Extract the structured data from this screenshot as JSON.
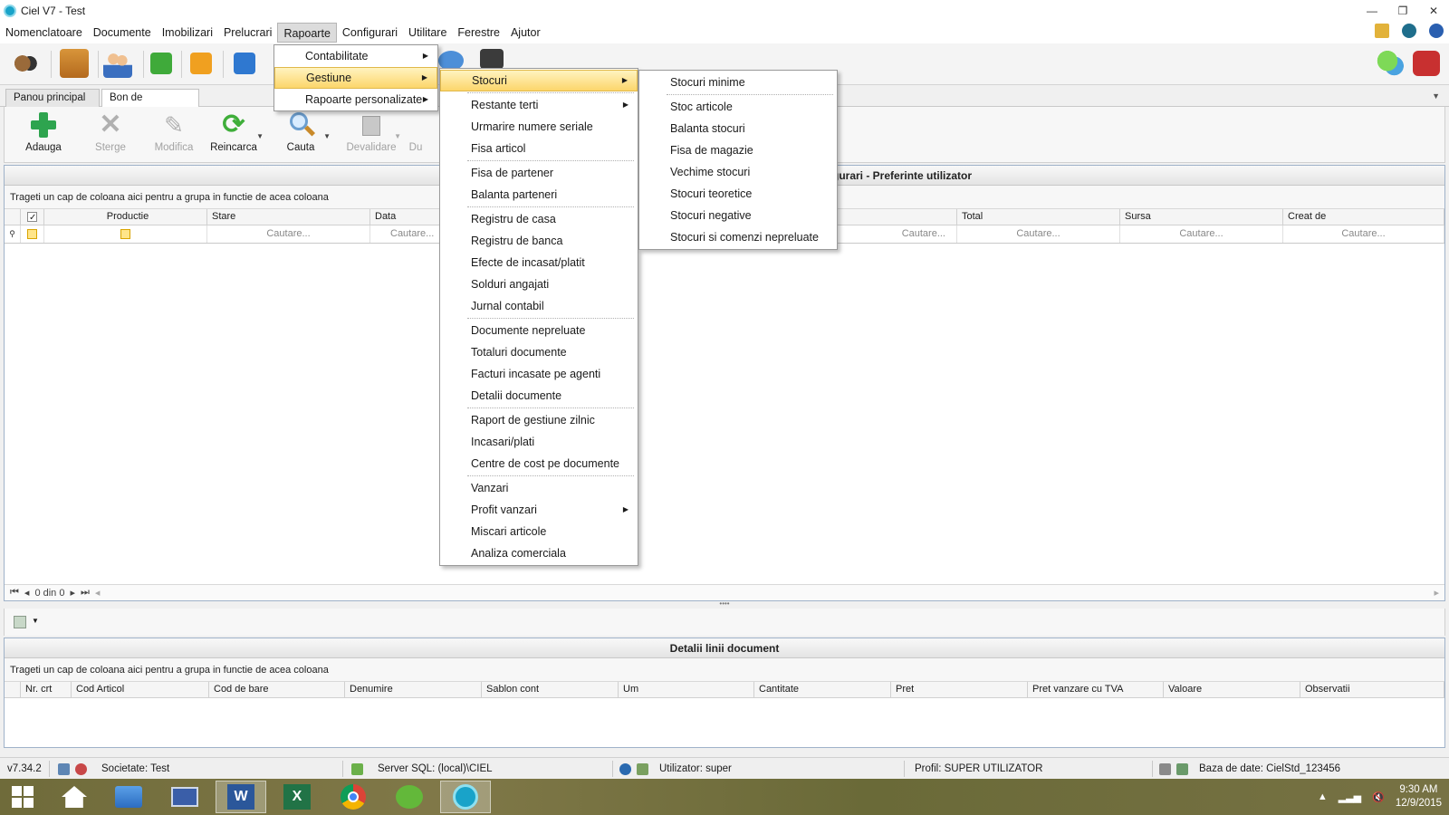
{
  "window": {
    "title": "Ciel V7 - Test",
    "controls": [
      "—",
      "❐",
      "✕"
    ]
  },
  "menubar": {
    "items": [
      "Nomenclatoare",
      "Documente",
      "Imobilizari",
      "Prelucrari",
      "Rapoarte",
      "Configurari",
      "Utilitare",
      "Ferestre",
      "Ajutor"
    ],
    "active": "Rapoarte"
  },
  "tabs": {
    "home": "Panou principal",
    "current": "Bon de consum",
    "close": "✕"
  },
  "ribbon": {
    "add": "Adauga",
    "delete": "Sterge",
    "edit": "Modifica",
    "reload": "Reincarca",
    "search": "Cauta",
    "invalidate": "Devalidare",
    "duplicate": "Du"
  },
  "main_grid": {
    "title_partial": "gurari - Preferinte utilizator",
    "group_hint": "Trageti un cap de coloana aici pentru a grupa in functie de acea coloana",
    "columns_left": [
      "Productie",
      "Stare",
      "Data"
    ],
    "columns_right": [
      "t",
      "Total",
      "Sursa",
      "Creat de"
    ],
    "search_placeholder": "Cautare...",
    "pager": "0 din 0"
  },
  "detail_grid": {
    "title": "Detalii linii document",
    "group_hint": "Trageti un cap de coloana aici pentru a grupa in functie de acea coloana",
    "columns": [
      "Nr. crt",
      "Cod Articol",
      "Cod de bare",
      "Denumire",
      "Sablon cont",
      "Um",
      "Cantitate",
      "Pret",
      "Pret vanzare cu TVA",
      "Valoare",
      "Observatii"
    ]
  },
  "menu_rapoarte": {
    "items": [
      "Contabilitate",
      "Gestiune",
      "Rapoarte personalizate"
    ],
    "highlighted": "Gestiune"
  },
  "menu_gestiune": {
    "items": [
      "Stocuri",
      "Restante terti",
      "Urmarire numere seriale",
      "Fisa articol",
      "Fisa de partener",
      "Balanta parteneri",
      "Registru de casa",
      "Registru de banca",
      "Efecte de incasat/platit",
      "Solduri angajati",
      "Jurnal contabil",
      "Documente nepreluate",
      "Totaluri documente",
      "Facturi incasate pe agenti",
      "Detalii documente",
      "Raport de gestiune zilnic",
      "Incasari/plati",
      "Centre de cost pe documente",
      "Vanzari",
      "Profit vanzari",
      "Miscari articole",
      "Analiza comerciala"
    ],
    "highlighted": "Stocuri"
  },
  "menu_stocuri": {
    "items": [
      "Stocuri minime",
      "Stoc articole",
      "Balanta stocuri",
      "Fisa de magazie",
      "Vechime stocuri",
      "Stocuri teoretice",
      "Stocuri negative",
      "Stocuri si comenzi nepreluate"
    ]
  },
  "statusbar": {
    "version": "v7.34.2",
    "company": "Societate: Test",
    "server": "Server SQL: (local)\\CIEL",
    "user": "Utilizator: super",
    "profile": "Profil: SUPER UTILIZATOR",
    "database": "Baza de date: CielStd_123456"
  },
  "taskbar": {
    "time": "9:30 AM",
    "date": "12/9/2015"
  },
  "colors": {
    "accent_highlight": "#fcd66b",
    "panel_border": "#9fb2c9",
    "taskbar": "#76703f"
  }
}
